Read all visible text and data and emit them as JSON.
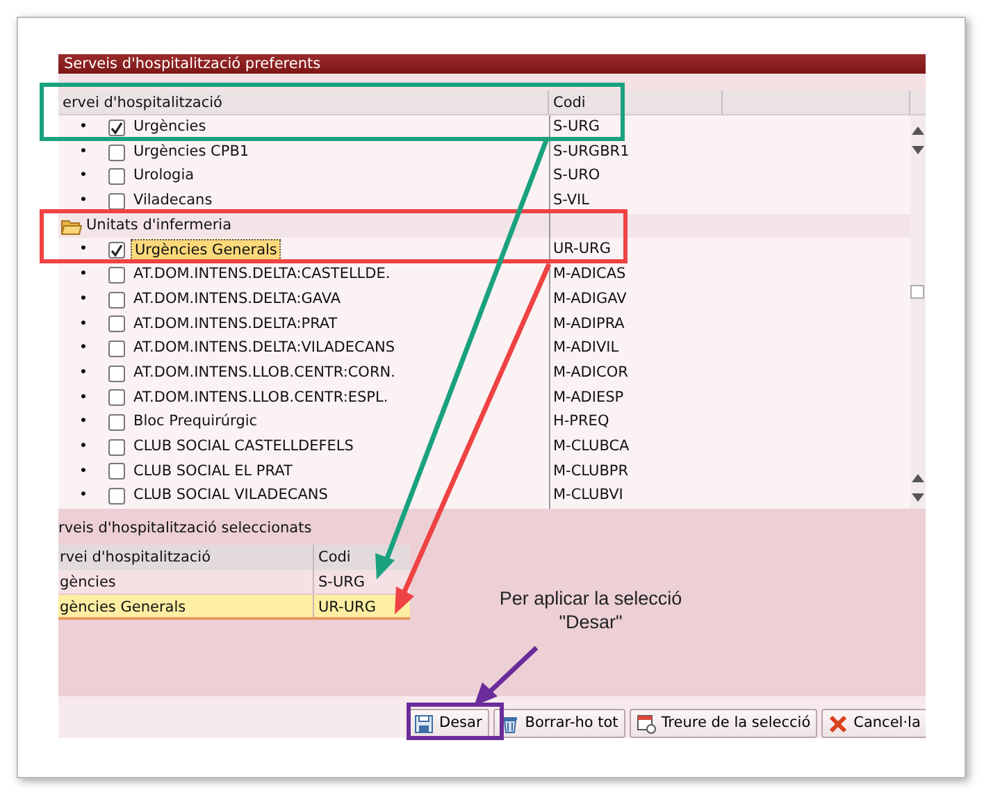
{
  "window": {
    "title": "Serveis d'hospitalització preferents"
  },
  "tree": {
    "columns": [
      "ervei d'hospitalització",
      "Codi"
    ],
    "rows": [
      {
        "kind": "leaf",
        "bullet": "•",
        "label": "Urgències",
        "code": "S-URG",
        "checked": true,
        "selected": false
      },
      {
        "kind": "leaf",
        "bullet": "•",
        "label": "Urgències CPB1",
        "code": "S-URGBR1",
        "checked": false,
        "selected": false
      },
      {
        "kind": "leaf",
        "bullet": "•",
        "label": "Urologia",
        "code": "S-URO",
        "checked": false,
        "selected": false
      },
      {
        "kind": "leaf",
        "bullet": "•",
        "label": "Viladecans",
        "code": "S-VIL",
        "checked": false,
        "selected": false
      },
      {
        "kind": "folder",
        "label": "Unitats d'infermeria",
        "children": [
          {
            "kind": "leaf",
            "bullet": "•",
            "label": "Urgències Generals",
            "code": "UR-URG",
            "checked": true,
            "selected": true
          },
          {
            "kind": "leaf",
            "bullet": "•",
            "label": "AT.DOM.INTENS.DELTA:CASTELLDE.",
            "code": "M-ADICAS",
            "checked": false,
            "selected": false
          },
          {
            "kind": "leaf",
            "bullet": "•",
            "label": "AT.DOM.INTENS.DELTA:GAVA",
            "code": "M-ADIGAV",
            "checked": false,
            "selected": false
          },
          {
            "kind": "leaf",
            "bullet": "•",
            "label": "AT.DOM.INTENS.DELTA:PRAT",
            "code": "M-ADIPRA",
            "checked": false,
            "selected": false
          },
          {
            "kind": "leaf",
            "bullet": "•",
            "label": "AT.DOM.INTENS.DELTA:VILADECANS",
            "code": "M-ADIVIL",
            "checked": false,
            "selected": false
          },
          {
            "kind": "leaf",
            "bullet": "•",
            "label": "AT.DOM.INTENS.LLOB.CENTR:CORN.",
            "code": "M-ADICOR",
            "checked": false,
            "selected": false
          },
          {
            "kind": "leaf",
            "bullet": "•",
            "label": "AT.DOM.INTENS.LLOB.CENTR:ESPL.",
            "code": "M-ADIESP",
            "checked": false,
            "selected": false
          },
          {
            "kind": "leaf",
            "bullet": "•",
            "label": "Bloc Prequirúrgic",
            "code": "H-PREQ",
            "checked": false,
            "selected": false
          },
          {
            "kind": "leaf",
            "bullet": "•",
            "label": "CLUB SOCIAL CASTELLDEFELS",
            "code": "M-CLUBCA",
            "checked": false,
            "selected": false
          },
          {
            "kind": "leaf",
            "bullet": "•",
            "label": "CLUB SOCIAL EL PRAT",
            "code": "M-CLUBPR",
            "checked": false,
            "selected": false
          },
          {
            "kind": "leaf",
            "bullet": "•",
            "label": "CLUB SOCIAL VILADECANS",
            "code": "M-CLUBVI",
            "checked": false,
            "selected": false
          }
        ]
      }
    ]
  },
  "selected_table": {
    "title": "rveis d'hospitalització seleccionats",
    "columns": [
      "rvei d'hospitalització",
      "Codi"
    ],
    "rows": [
      {
        "name": "gències",
        "code": "S-URG",
        "selected": false
      },
      {
        "name": "gències Generals",
        "code": "UR-URG",
        "selected": true
      }
    ]
  },
  "buttons": [
    {
      "kind": "save",
      "label": "Desar"
    },
    {
      "kind": "delete",
      "label": "Borrar-ho tot"
    },
    {
      "kind": "remove",
      "label": "Treure de la selecció"
    },
    {
      "kind": "cancel",
      "label": "Cancel·la"
    }
  ],
  "annotation": {
    "text": "Per aplicar la selecció\n\"Desar\""
  }
}
